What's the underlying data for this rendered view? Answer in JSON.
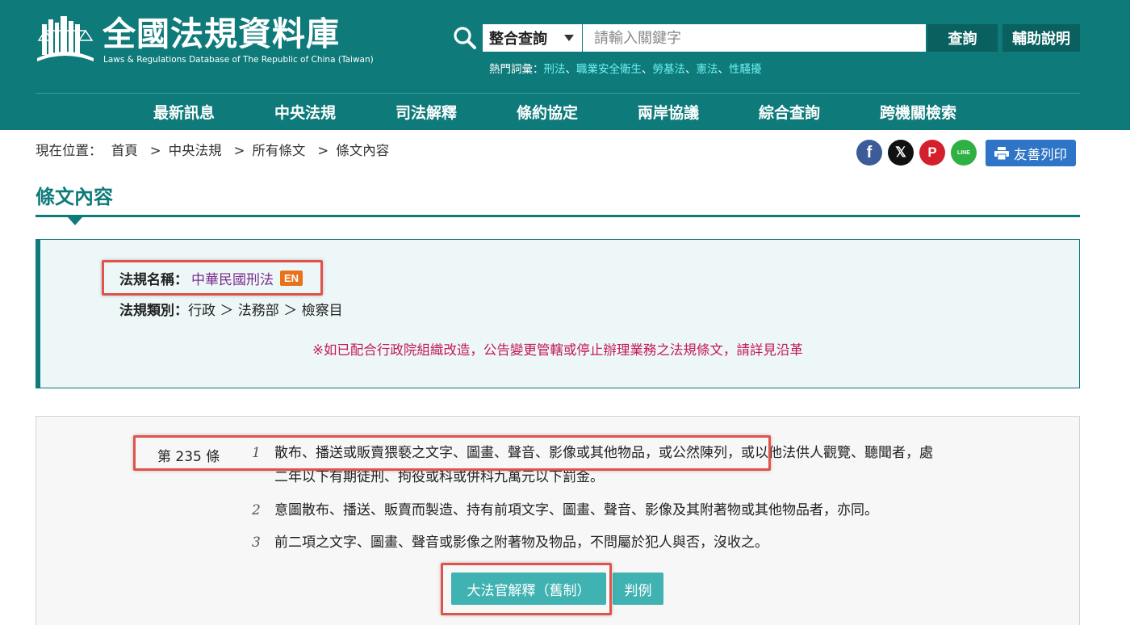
{
  "header": {
    "title": "全國法規資料庫",
    "subtitle": "Laws & Regulations Database of The Republic of China (Taiwan)",
    "search_scope": "整合查詢",
    "search_placeholder": "請輸入關鍵字",
    "search_button": "查詢",
    "help_button": "輔助說明",
    "hot_words_label": "熱門詞彙：",
    "hot_words": [
      "刑法",
      "職業安全衛生",
      "勞基法",
      "憲法",
      "性騷擾"
    ],
    "hot_word_sep": "、"
  },
  "nav": [
    "最新訊息",
    "中央法規",
    "司法解釋",
    "條約協定",
    "兩岸協議",
    "綜合查詢",
    "跨機關檢索"
  ],
  "breadcrumb": {
    "label": "現在位置：",
    "items": [
      "首頁",
      "中央法規",
      "所有條文",
      "條文內容"
    ],
    "separator": ">"
  },
  "share": {
    "facebook": "f",
    "x": "𝕏",
    "plurk": "P",
    "line": "LINE",
    "print_label": "友善列印"
  },
  "page_title": "條文內容",
  "law_info": {
    "name_label": "法規名稱：",
    "name": "中華民國刑法",
    "en_badge": "EN",
    "category_label": "法規類別：",
    "category": "行政 ＞ 法務部 ＞ 檢察目",
    "notice": "※如已配合行政院組織改造，公告變更管轄或停止辦理業務之法規條文，請詳見沿革"
  },
  "article": {
    "number": "第 235 條",
    "paragraphs": [
      {
        "num": "1",
        "line1": "散布、播送或販賣猥褻之文字、圖畫、聲音、影像或其他物品，或公然陳列，或以他法供人觀覽、聽聞者，處",
        "line2": "二年以下有期徒刑、拘役或科或併科九萬元以下罰金。"
      },
      {
        "num": "2",
        "line1": "意圖散布、播送、販賣而製造、持有前項文字、圖畫、聲音、影像及其附著物或其他物品者，亦同。"
      },
      {
        "num": "3",
        "line1": "前二項之文字、圖畫、聲音或影像之附著物及物品，不問屬於犯人與否，沒收之。"
      }
    ],
    "buttons": [
      "大法官解釋（舊制）",
      "判例"
    ]
  },
  "colors": {
    "brand": "#0f7a7a",
    "brand_dark": "#0a5f5f",
    "link_purple": "#7b2d8e",
    "notice_red": "#c2185b",
    "badge_orange": "#e8731b",
    "button_teal": "#40b2b2",
    "highlight_red": "#e0534a"
  }
}
